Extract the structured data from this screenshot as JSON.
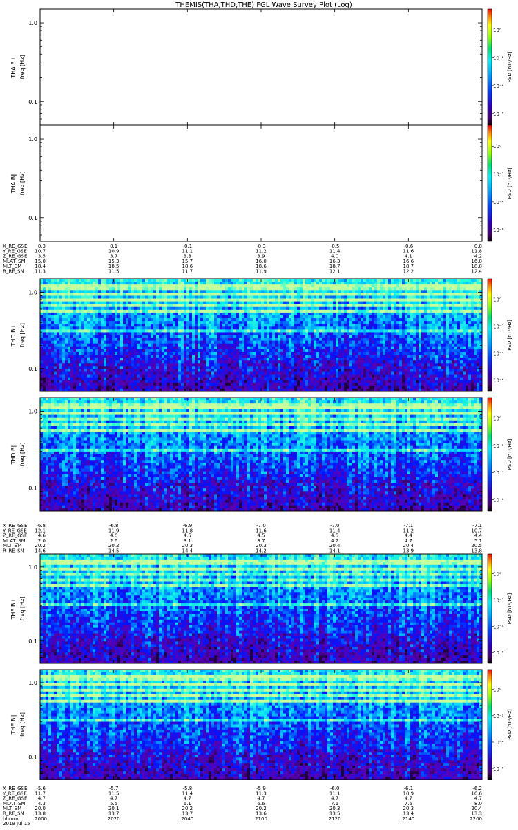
{
  "title": "THEMIS(THA,THD,THE) FGL Wave Survey Plot (Log)",
  "colorbar": {
    "label": "PSD [nT²/Hz]",
    "ticks": [
      "10⁰",
      "10⁻²",
      "10⁻⁴",
      "10⁻⁶"
    ]
  },
  "chart_data": {
    "type": "heatmap",
    "colormap": "rainbow (black-purple-blue-cyan-green-yellow-red)",
    "panels": [
      {
        "id": "tha_bl",
        "ylabel": "THA B⊥",
        "yunit": "freq [Hz]",
        "yticks": [
          "1.0",
          "0.1"
        ],
        "has_data": false
      },
      {
        "id": "tha_bpar",
        "ylabel": "THA B∥",
        "yunit": "freq [Hz]",
        "yticks": [
          "1.0",
          "0.1"
        ],
        "has_data": false
      },
      {
        "id": "thd_bl",
        "ylabel": "THD B⊥",
        "yunit": "freq [Hz]",
        "yticks": [
          "1.0",
          "0.1"
        ],
        "has_data": true
      },
      {
        "id": "thd_bpar",
        "ylabel": "THD B∥",
        "yunit": "freq [Hz]",
        "yticks": [
          "1.0",
          "0.1"
        ],
        "has_data": true
      },
      {
        "id": "the_bl",
        "ylabel": "THE B⊥",
        "yunit": "freq [Hz]",
        "yticks": [
          "1.0",
          "0.1"
        ],
        "has_data": true
      },
      {
        "id": "the_bpar",
        "ylabel": "THE B∥",
        "yunit": "freq [Hz]",
        "yticks": [
          "1.0",
          "0.1"
        ],
        "has_data": true
      }
    ],
    "ephemeris": [
      {
        "probe": "THA",
        "rows": [
          {
            "label": "X_RE_GSE",
            "values": [
              "0.3",
              "0.1",
              "-0.1",
              "-0.3",
              "-0.5",
              "-0.6",
              "-0.8"
            ]
          },
          {
            "label": "Y_RE_GSE",
            "values": [
              "10.7",
              "10.9",
              "11.1",
              "11.2",
              "11.4",
              "11.6",
              "11.8"
            ]
          },
          {
            "label": "Z_RE_GSE",
            "values": [
              "3.5",
              "3.7",
              "3.8",
              "3.9",
              "4.0",
              "4.1",
              "4.2"
            ]
          },
          {
            "label": "MLAT_SM",
            "values": [
              "15.0",
              "15.3",
              "15.7",
              "16.0",
              "16.3",
              "16.6",
              "16.8"
            ]
          },
          {
            "label": "MLT_SM",
            "values": [
              "18.4",
              "18.5",
              "18.6",
              "18.6",
              "18.7",
              "18.7",
              "18.8"
            ]
          },
          {
            "label": "R_RE_SM",
            "values": [
              "11.3",
              "11.5",
              "11.7",
              "11.9",
              "12.1",
              "12.2",
              "12.4"
            ]
          }
        ]
      },
      {
        "probe": "THD",
        "rows": [
          {
            "label": "X_RE_GSE",
            "values": [
              "-6.8",
              "-6.8",
              "-6.9",
              "-7.0",
              "-7.0",
              "-7.1",
              "-7.1"
            ]
          },
          {
            "label": "Y_RE_GSE",
            "values": [
              "12.1",
              "11.9",
              "11.8",
              "11.6",
              "11.4",
              "11.2",
              "10.7"
            ]
          },
          {
            "label": "Z_RE_GSE",
            "values": [
              "4.6",
              "4.6",
              "4.5",
              "4.5",
              "4.5",
              "4.4",
              "4.4"
            ]
          },
          {
            "label": "MLAT_SM",
            "values": [
              "2.0",
              "2.6",
              "3.1",
              "3.7",
              "4.2",
              "4.7",
              "5.1"
            ]
          },
          {
            "label": "MLT_SM",
            "values": [
              "20.2",
              "20.2",
              "20.3",
              "20.3",
              "20.4",
              "20.4",
              "20.5"
            ]
          },
          {
            "label": "R_RE_SM",
            "values": [
              "14.6",
              "14.5",
              "14.4",
              "14.2",
              "14.1",
              "13.9",
              "13.8"
            ]
          }
        ]
      },
      {
        "probe": "THE",
        "rows": [
          {
            "label": "X_RE_GSE",
            "values": [
              "-5.6",
              "-5.7",
              "-5.8",
              "-5.9",
              "-6.0",
              "-6.1",
              "-6.2"
            ]
          },
          {
            "label": "Y_RE_GSE",
            "values": [
              "11.7",
              "11.5",
              "11.4",
              "11.3",
              "11.1",
              "10.9",
              "10.6"
            ]
          },
          {
            "label": "Z_RE_GSE",
            "values": [
              "4.7",
              "4.7",
              "4.7",
              "4.7",
              "4.7",
              "4.7",
              "4.7"
            ]
          },
          {
            "label": "MLAT_SM",
            "values": [
              "4.3",
              "5.5",
              "6.1",
              "6.6",
              "7.1",
              "7.6",
              "8.0"
            ]
          },
          {
            "label": "MLT_SM",
            "values": [
              "20.0",
              "20.1",
              "20.2",
              "20.2",
              "20.3",
              "20.3",
              "20.4"
            ]
          },
          {
            "label": "R_RE_SM",
            "values": [
              "13.8",
              "13.7",
              "13.7",
              "13.6",
              "13.5",
              "13.4",
              "13.3"
            ]
          }
        ]
      }
    ],
    "time_axis": {
      "label": "hhmm",
      "ticks": [
        "2000",
        "2020",
        "2040",
        "2100",
        "2120",
        "2140",
        "2200"
      ],
      "date": "2019 Jul 15"
    }
  }
}
